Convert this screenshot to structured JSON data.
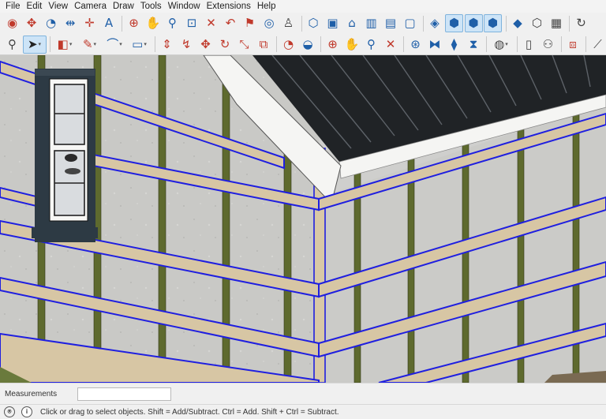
{
  "menu": [
    "File",
    "Edit",
    "View",
    "Camera",
    "Draw",
    "Tools",
    "Window",
    "Extensions",
    "Help"
  ],
  "toolbar_top": [
    {
      "name": "orbit-icon",
      "glyph": "◉",
      "color": "#c0392b"
    },
    {
      "name": "pan-icon",
      "glyph": "✥",
      "color": "#c0392b"
    },
    {
      "name": "protractor-icon",
      "glyph": "◔",
      "color": "#1f5fa8"
    },
    {
      "name": "dimension-icon",
      "glyph": "⇹",
      "color": "#1f5fa8"
    },
    {
      "name": "axes-icon",
      "glyph": "✛",
      "color": "#c0392b"
    },
    {
      "name": "text-a-icon",
      "glyph": "A",
      "color": "#1f5fa8"
    },
    {
      "name": "sep"
    },
    {
      "name": "section-plane-icon",
      "glyph": "⊕",
      "color": "#c0392b"
    },
    {
      "name": "hand-icon",
      "glyph": "✋",
      "color": "#c0392b"
    },
    {
      "name": "zoom-icon",
      "glyph": "⚲",
      "color": "#1f5fa8"
    },
    {
      "name": "zoom-window-icon",
      "glyph": "⊡",
      "color": "#1f5fa8"
    },
    {
      "name": "zoom-extents-icon",
      "glyph": "✕",
      "color": "#c0392b"
    },
    {
      "name": "previous-view-icon",
      "glyph": "↶",
      "color": "#c0392b"
    },
    {
      "name": "position-camera-icon",
      "glyph": "⚑",
      "color": "#c0392b"
    },
    {
      "name": "look-around-icon",
      "glyph": "◎",
      "color": "#1f5fa8"
    },
    {
      "name": "walk-icon",
      "glyph": "♙",
      "color": "#444444"
    },
    {
      "name": "sep"
    },
    {
      "name": "iso-view-icon",
      "glyph": "⬡",
      "color": "#1f5fa8"
    },
    {
      "name": "top-view-icon",
      "glyph": "▣",
      "color": "#1f5fa8"
    },
    {
      "name": "front-view-icon",
      "glyph": "⌂",
      "color": "#1f5fa8"
    },
    {
      "name": "right-view-icon",
      "glyph": "▥",
      "color": "#1f5fa8"
    },
    {
      "name": "back-view-icon",
      "glyph": "▤",
      "color": "#1f5fa8"
    },
    {
      "name": "left-view-icon",
      "glyph": "▢",
      "color": "#1f5fa8"
    },
    {
      "name": "sep"
    },
    {
      "name": "xray-icon",
      "glyph": "◈",
      "color": "#1f5fa8"
    },
    {
      "name": "wireframe-icon",
      "glyph": "⬢",
      "color": "#1f5fa8",
      "active": true
    },
    {
      "name": "hidden-line-icon",
      "glyph": "⬢",
      "color": "#1f5fa8",
      "active": true
    },
    {
      "name": "shaded-icon",
      "glyph": "⬢",
      "color": "#1f5fa8",
      "active": true
    },
    {
      "name": "sep"
    },
    {
      "name": "component-icon",
      "glyph": "◆",
      "color": "#1f5fa8"
    },
    {
      "name": "make-group-icon",
      "glyph": "⬡",
      "color": "#444444"
    },
    {
      "name": "warehouse-icon",
      "glyph": "▦",
      "color": "#444444"
    },
    {
      "name": "sep"
    },
    {
      "name": "undo-icon",
      "glyph": "↻",
      "color": "#444444"
    }
  ],
  "toolbar_bottom": [
    {
      "name": "search-icon",
      "glyph": "⚲",
      "color": "#444444"
    },
    {
      "name": "select-icon",
      "glyph": "➤",
      "color": "#222222",
      "active": true,
      "drop": true
    },
    {
      "name": "sep"
    },
    {
      "name": "eraser-icon",
      "glyph": "◧",
      "color": "#c0392b",
      "drop": true
    },
    {
      "name": "line-pencil-icon",
      "glyph": "✎",
      "color": "#c0392b",
      "drop": true
    },
    {
      "name": "arc-icon",
      "glyph": "⌒",
      "color": "#1f5fa8",
      "drop": true
    },
    {
      "name": "rectangle-icon",
      "glyph": "▭",
      "color": "#1f5fa8",
      "drop": true
    },
    {
      "name": "sep"
    },
    {
      "name": "push-pull-icon",
      "glyph": "⇕",
      "color": "#c0392b"
    },
    {
      "name": "follow-me-icon",
      "glyph": "↯",
      "color": "#c0392b"
    },
    {
      "name": "move-icon",
      "glyph": "✥",
      "color": "#c0392b"
    },
    {
      "name": "rotate-icon",
      "glyph": "↻",
      "color": "#c0392b"
    },
    {
      "name": "scale-icon",
      "glyph": "⤡",
      "color": "#c0392b"
    },
    {
      "name": "offset-icon",
      "glyph": "⧉",
      "color": "#c0392b"
    },
    {
      "name": "sep"
    },
    {
      "name": "tape-measure-icon",
      "glyph": "◔",
      "color": "#c0392b"
    },
    {
      "name": "paint-bucket-icon",
      "glyph": "◒",
      "color": "#1f5fa8"
    },
    {
      "name": "sep"
    },
    {
      "name": "orbit-tool-icon",
      "glyph": "⊕",
      "color": "#c0392b"
    },
    {
      "name": "pan-tool-icon",
      "glyph": "✋",
      "color": "#c0392b"
    },
    {
      "name": "zoom-tool-icon",
      "glyph": "⚲",
      "color": "#1f5fa8"
    },
    {
      "name": "zoom-extents-tool-icon",
      "glyph": "✕",
      "color": "#c0392b"
    },
    {
      "name": "sep"
    },
    {
      "name": "warehouse-3d-icon",
      "glyph": "⊛",
      "color": "#1f5fa8"
    },
    {
      "name": "extension-icon",
      "glyph": "⧓",
      "color": "#1f5fa8"
    },
    {
      "name": "layers-icon",
      "glyph": "⧫",
      "color": "#1f5fa8"
    },
    {
      "name": "styles-icon",
      "glyph": "⧗",
      "color": "#1f5fa8"
    },
    {
      "name": "sep"
    },
    {
      "name": "account-icon",
      "glyph": "◍",
      "color": "#444444",
      "drop": true
    },
    {
      "name": "sep"
    },
    {
      "name": "new-file-icon",
      "glyph": "▯",
      "color": "#444444"
    },
    {
      "name": "user-icon",
      "glyph": "⚇",
      "color": "#444444"
    },
    {
      "name": "sep"
    },
    {
      "name": "section-fill-icon",
      "glyph": "⧈",
      "color": "#c0392b"
    },
    {
      "name": "sep"
    },
    {
      "name": "measure-tape-icon",
      "glyph": "⟋",
      "color": "#444444"
    }
  ],
  "measurements": {
    "label": "Measurements",
    "value": ""
  },
  "status": {
    "text": "Click or drag to select objects. Shift = Add/Subtract. Ctrl = Add. Shift + Ctrl = Subtract."
  },
  "colors": {
    "selection": "#1f1fe0",
    "wall": "#c9c9c6",
    "batten": "#d7c6a4",
    "stud": "#5e6a2e",
    "roof_trim": "#f5f5f3",
    "window_frame": "#2d3a44"
  }
}
